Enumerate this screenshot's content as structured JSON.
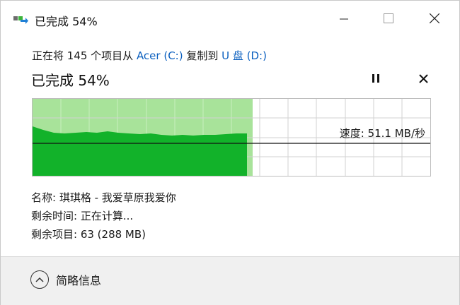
{
  "window": {
    "title": "已完成 54%",
    "controls": {
      "minimize_icon": "minimize-icon",
      "maximize_icon": "maximize-icon",
      "close_icon": "close-icon"
    }
  },
  "copy": {
    "prefix": "正在将 145 个项目从 ",
    "source": "Acer (C:)",
    "middle": " 复制到 ",
    "destination": "U 盘 (D:)"
  },
  "progress": {
    "title": "已完成 54%",
    "percent": 54,
    "pause_icon": "pause-icon",
    "cancel_icon": "close-icon"
  },
  "speed": {
    "label": "速度: 51.1 MB/秒",
    "current_fraction": 0.57
  },
  "details": {
    "name": "名称:  琪琪格 - 我爱草原我爱你",
    "time_remaining": "剩余时间:  正在计算...",
    "items_remaining": "剩余项目:  63 (288 MB)"
  },
  "footer": {
    "less_details_label": "简略信息",
    "icon": "chevron-up-icon"
  },
  "colors": {
    "fill_light": "#a8e39a",
    "fill_dark": "#12b22a",
    "link": "#0a5fbf",
    "grid": "#d2d2d2"
  }
}
